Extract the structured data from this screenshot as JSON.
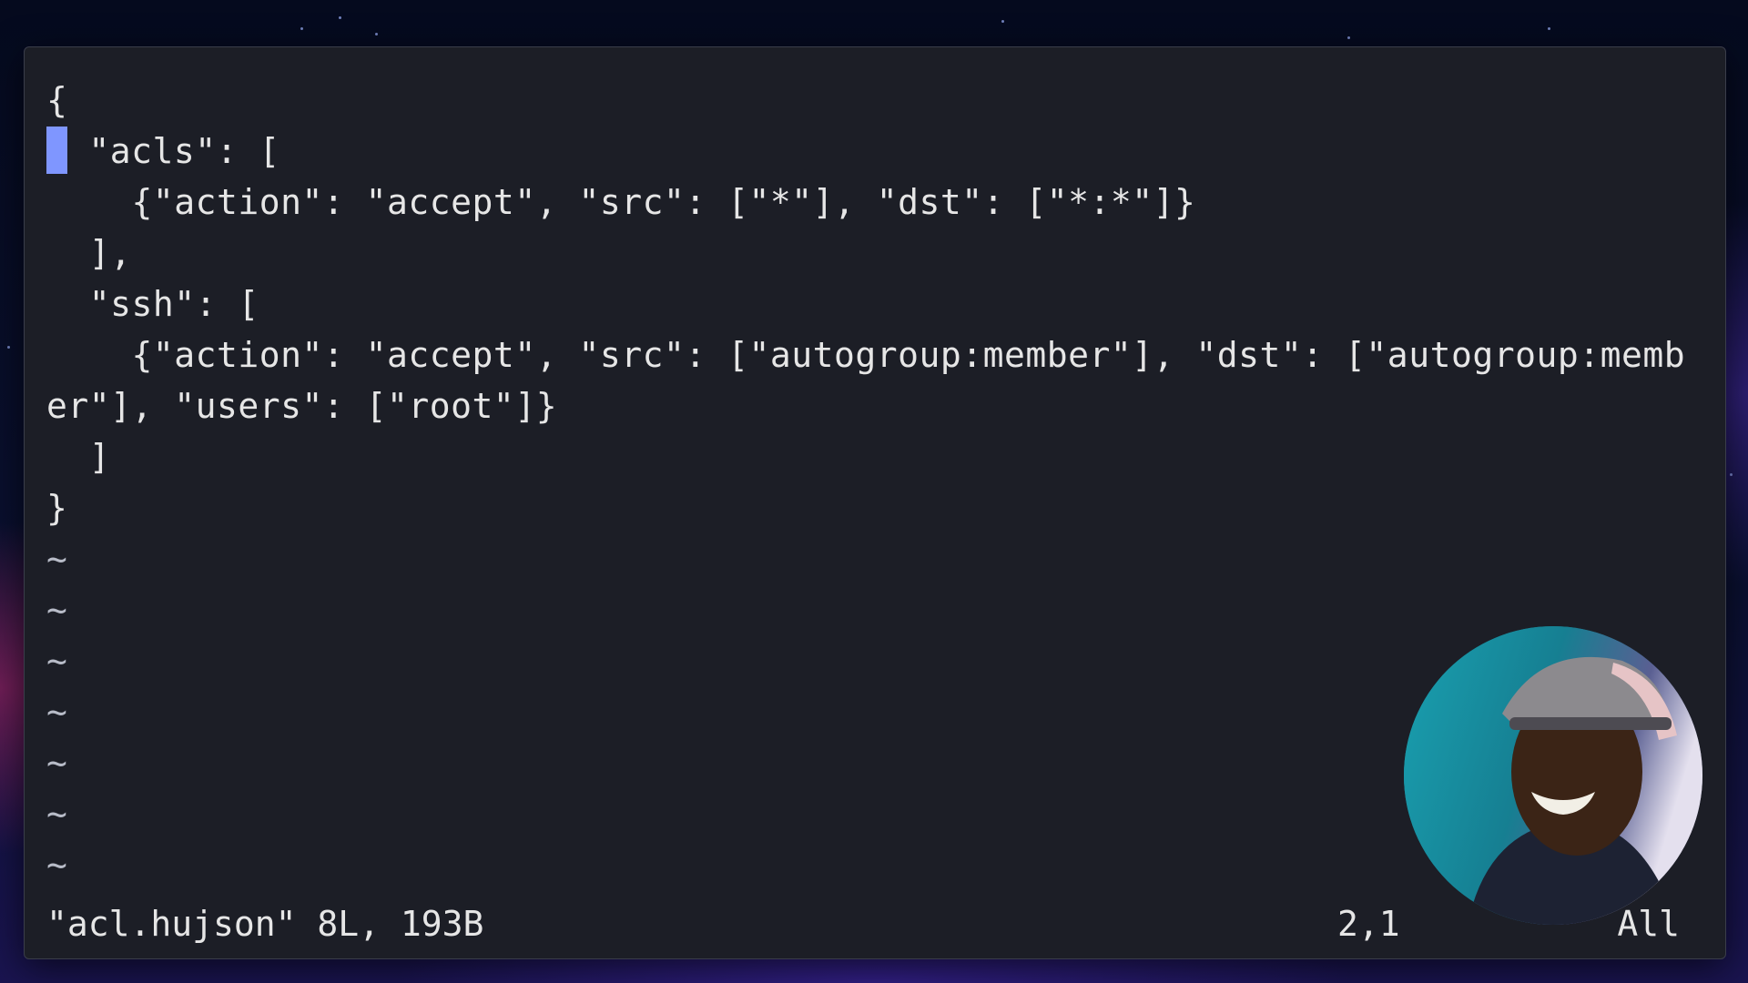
{
  "editor": {
    "lines": [
      "{",
      " \"acls\": [",
      "    {\"action\": \"accept\", \"src\": [\"*\"], \"dst\": [\"*:*\"]}",
      "  ],",
      "  \"ssh\": [",
      "    {\"action\": \"accept\", \"src\": [\"autogroup:member\"], \"dst\": [\"autogroup:memb",
      "er\"], \"users\": [\"root\"]}",
      "  ]",
      "}"
    ],
    "tildes": [
      "~",
      "~",
      "~",
      "~",
      "~",
      "~",
      "~"
    ]
  },
  "status": {
    "file_info": "\"acl.hujson\" 8L, 193B",
    "cursor_position": "2,1",
    "scroll": "All"
  },
  "colors": {
    "background": "#1c1e26",
    "text": "#e6e6e6",
    "cursor": "#7f96ff"
  }
}
